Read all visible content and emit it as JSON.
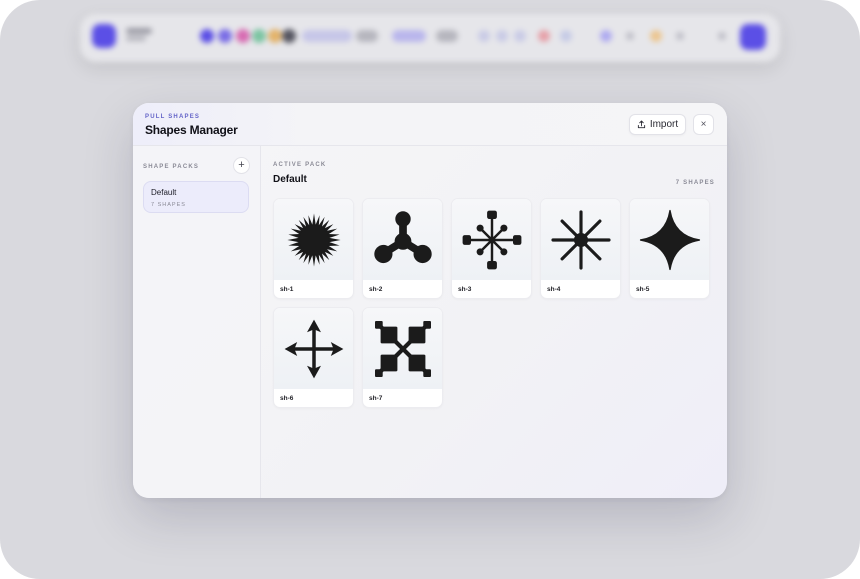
{
  "modal": {
    "eyebrow": "PULL SHAPES",
    "title": "Shapes Manager",
    "import_label": "Import",
    "close_glyph": "×"
  },
  "sidebar": {
    "heading": "SHAPE PACKS",
    "add_glyph": "+",
    "packs": [
      {
        "name": "Default",
        "count": "7 SHAPES",
        "selected": true
      }
    ]
  },
  "main": {
    "eyebrow": "ACTIVE PACK",
    "title": "Default",
    "count": "7 SHAPES",
    "shapes": [
      {
        "label": "sh-1",
        "icon": "sunburst-icon"
      },
      {
        "label": "sh-2",
        "icon": "tri-node-icon"
      },
      {
        "label": "sh-3",
        "icon": "network-asterisk-icon"
      },
      {
        "label": "sh-4",
        "icon": "star-burst-icon"
      },
      {
        "label": "sh-5",
        "icon": "four-point-star-icon"
      },
      {
        "label": "sh-6",
        "icon": "four-arrows-icon"
      },
      {
        "label": "sh-7",
        "icon": "quad-block-x-icon"
      }
    ]
  },
  "colors": {
    "accent": "#5a4fe0",
    "eyebrow": "#6464c8",
    "selected_pack_bg": "#ececfb",
    "shape_fill": "#1b1b1b"
  }
}
